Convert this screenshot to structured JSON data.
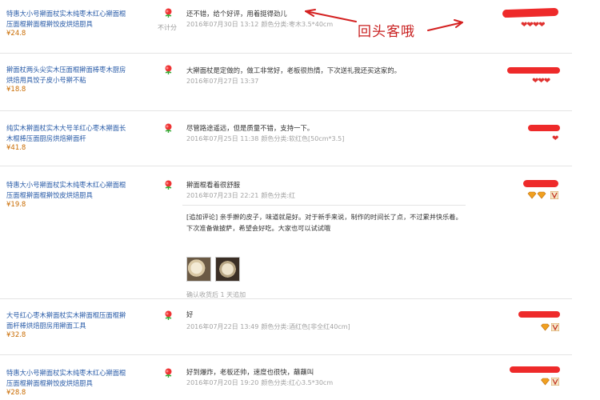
{
  "reviews": [
    {
      "product_title": "特惠大小号擀面杖实木纯枣木红心擀面棍压面棍擀面棍擀饺皮烘焙厨具",
      "product_price": "¥24.8",
      "no_score_label": "不计分",
      "comment": "还不错，给个好评，用着挺得劲儿",
      "date": "2016年07月30日 13:12",
      "spec": "颜色分类:枣木3.5*40cm",
      "buyer_level_hearts": "❤❤❤❤"
    },
    {
      "product_title": "擀面杖两头尖实木压面棍擀面棒枣木厨房烘焙用具饺子皮小号擀不粘",
      "product_price": "¥18.8",
      "comment": "大擀面杖是定做的，做工非常好，老板很热情，下次送礼我还买这家的。",
      "date": "2016年07月27日 13:37",
      "spec": "",
      "buyer_level_hearts": "❤❤❤"
    },
    {
      "product_title": "纯实木擀面杖实木大号羊红心枣木擀面长木棍棒压面厨房烘焙擀面杆",
      "product_price": "¥41.8",
      "comment": "尽管路途遥远，但是质量不错，支持一下。",
      "date": "2016年07月25日 11:38",
      "spec": "颜色分类:软红色[50cm*3.5]",
      "buyer_level_hearts": "❤"
    },
    {
      "product_title": "特惠大小号擀面杖实木纯枣木红心擀面棍压面棍擀面棍擀饺皮烘焙厨具",
      "product_price": "¥19.8",
      "comment": "擀面棍看着很舒服",
      "date": "2016年07月23日 22:21",
      "spec": "颜色分类:红",
      "additional_review": "[追加评论] 亲手擀的皮子，味道就是好。对于新手来说，制作的时间长了点，不过累并快乐着。下次准备做披萨，希望会好吃。大家也可以试试哦",
      "additional_time": "确认收货后 1 天追加"
    },
    {
      "product_title": "大号红心枣木擀面杖实木擀面棍压面棍擀面杆棒烘焙厨房用擀面工具",
      "product_price": "¥32.8",
      "comment": "好",
      "date": "2016年07月22日 13:49",
      "spec": "颜色分类:酒红色[非全红40cm]"
    },
    {
      "product_title": "特惠大小号擀面杖实木纯枣木红心擀面棍压面棍擀面棍擀饺皮烘焙厨具",
      "product_price": "¥28.8",
      "comment": "好到爆炸，老板还帅，速度也很快，蘸蘸叫",
      "date": "2016年07月20日 19:20",
      "spec": "颜色分类:红心3.5*30cm"
    }
  ],
  "annotation": {
    "text": "回头客哦",
    "color": "#c81e1e"
  },
  "colors": {
    "product_link": "#2a5ca8",
    "price": "#c96b00",
    "meta": "#a3a3a3",
    "smudge": "#ee2a2a"
  },
  "icons": {
    "rating": "red-flower-icon",
    "buyer_level": "heart-icon",
    "diamond": "diamond-icon",
    "vip": "vip-badge-icon"
  }
}
